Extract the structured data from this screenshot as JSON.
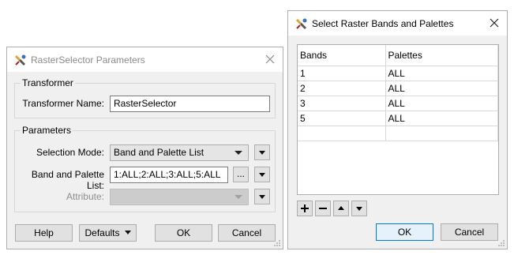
{
  "left_dialog": {
    "title": "RasterSelector Parameters",
    "transformer_group": {
      "label": "Transformer",
      "name_label": "Transformer Name:",
      "name_value": "RasterSelector"
    },
    "parameters_group": {
      "label": "Parameters",
      "selection_mode_label": "Selection Mode:",
      "selection_mode_value": "Band and Palette List",
      "band_palette_label": "Band and Palette List:",
      "band_palette_value": "1:ALL;2:ALL;3:ALL;5:ALL",
      "browse_label": "...",
      "attribute_label": "Attribute:",
      "attribute_value": ""
    },
    "buttons": {
      "help": "Help",
      "defaults": "Defaults",
      "ok": "OK",
      "cancel": "Cancel"
    }
  },
  "right_dialog": {
    "title": "Select Raster Bands and Palettes",
    "table": {
      "columns": [
        "Bands",
        "Palettes"
      ],
      "rows": [
        [
          "1",
          "ALL"
        ],
        [
          "2",
          "ALL"
        ],
        [
          "3",
          "ALL"
        ],
        [
          "5",
          "ALL"
        ],
        [
          "",
          ""
        ]
      ]
    },
    "buttons": {
      "ok": "OK",
      "cancel": "Cancel"
    }
  }
}
